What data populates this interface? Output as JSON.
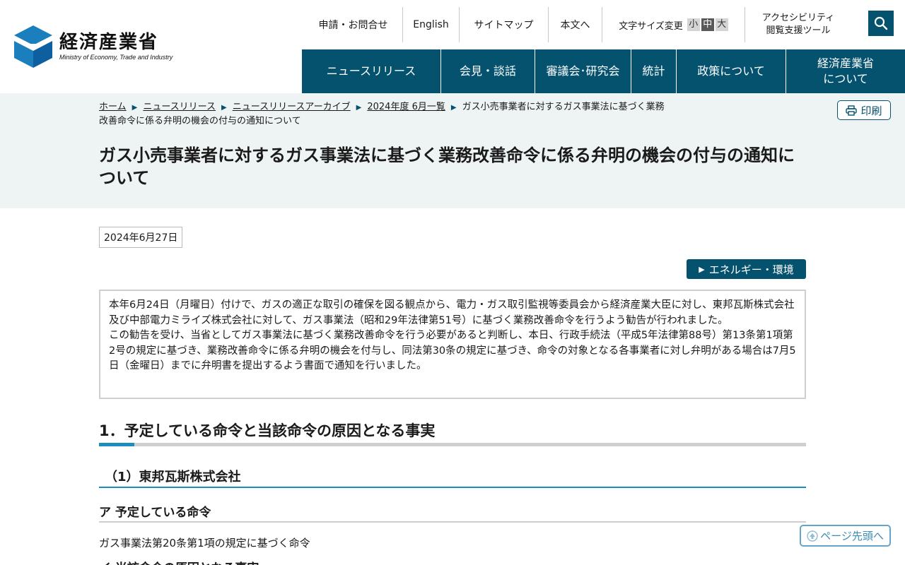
{
  "header": {
    "logo_ja": "経済産業省",
    "logo_en": "Ministry of Economy, Trade and Industry",
    "util": {
      "contact": "申請・お問合せ",
      "english": "English",
      "sitemap": "サイトマップ",
      "to_main": "本文へ",
      "font_size_label": "文字サイズ変更",
      "font_small": "小",
      "font_medium": "中",
      "font_large": "大",
      "accessibility_line1": "アクセシビリティ",
      "accessibility_line2": "閲覧支援ツール"
    },
    "search_icon": "search-icon"
  },
  "gnav": {
    "items": [
      {
        "label": "ニュースリリース"
      },
      {
        "label": "会見・談話"
      },
      {
        "label": "審議会･研究会"
      },
      {
        "label": "統計"
      },
      {
        "label": "政策について"
      },
      {
        "label_line1": "経済産業省",
        "label_line2": "について"
      }
    ]
  },
  "breadcrumb": {
    "items": [
      "ホーム",
      "ニュースリリース",
      "ニュースリリースアーカイブ",
      "2024年度 6月一覧"
    ],
    "current": "ガス小売事業者に対するガス事業法に基づく業務改善命令に係る弁明の機会の付与の通知について"
  },
  "print_label": "印刷",
  "page_title": "ガス小売事業者に対するガス事業法に基づく業務改善命令に係る弁明の機会の付与の通知について",
  "date": "2024年6月27日",
  "category_tag": "エネルギー・環境",
  "intro": {
    "p1": "本年6月24日（月曜日）付けで、ガスの適正な取引の確保を図る観点から、電力・ガス取引監視等委員会から経済産業大臣に対し、東邦瓦斯株式会社及び中部電力ミライズ株式会社に対して、ガス事業法（昭和29年法律第51号）に基づく業務改善命令を行うよう勧告が行われました。",
    "p2": "この勧告を受け、当省としてガス事業法に基づく業務改善命令を行う必要があると判断し、本日、行政手続法（平成5年法律第88号）第13条第1項第2号の規定に基づき、業務改善命令に係る弁明の機会を付与し、同法第30条の規定に基づき、命令の対象となる各事業者に対し弁明がある場合は7月5日（金曜日）までに弁明書を提出するよう書面で通知を行いました。"
  },
  "section1": {
    "heading": "1．予定している命令と当該命令の原因となる事実",
    "sub1": {
      "heading": "（1）東邦瓦斯株式会社",
      "a_heading": "ア 予定している命令",
      "a_text": "ガス事業法第20条第1項の規定に基づく命令",
      "b_heading": "イ 当該命令の原因となる事実"
    }
  },
  "to_top_label": "ページ先頭へ",
  "colors": {
    "brand": "#05526f",
    "accent_blue": "#1b8ec0",
    "band_bg": "#eef3f3"
  }
}
